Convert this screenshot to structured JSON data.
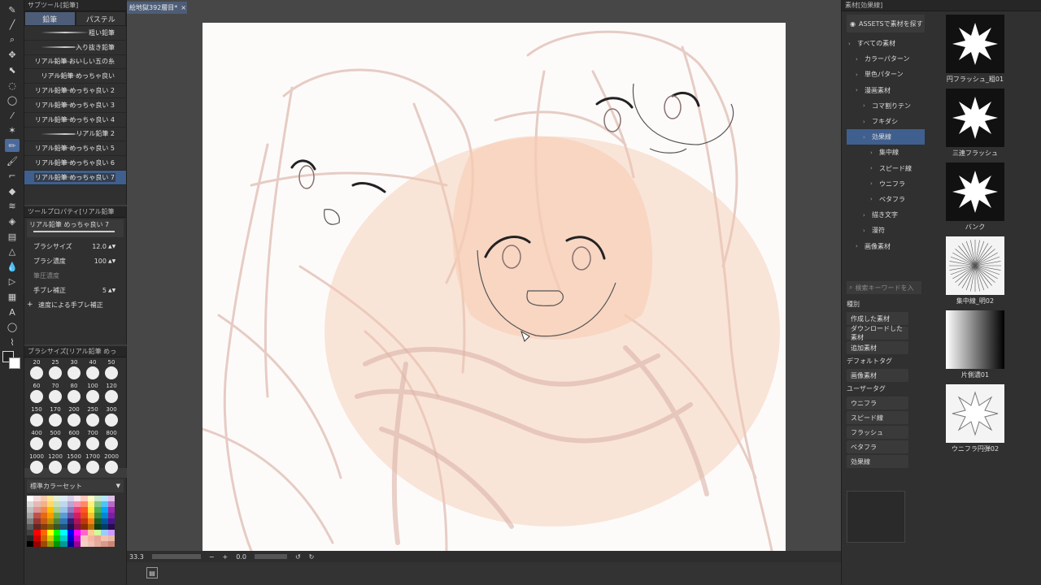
{
  "toolbar": {
    "tools": [
      {
        "name": "pen-icon",
        "glyph": "✎"
      },
      {
        "name": "line-icon",
        "glyph": "╱"
      },
      {
        "name": "zoom-icon",
        "glyph": "⌕"
      },
      {
        "name": "move-icon",
        "glyph": "✥"
      },
      {
        "name": "object-icon",
        "glyph": "⬉"
      },
      {
        "name": "select-icon",
        "glyph": "◌"
      },
      {
        "name": "lasso-icon",
        "glyph": "◯"
      },
      {
        "name": "eyedropper-icon",
        "glyph": "⁄"
      },
      {
        "name": "magic-wand-icon",
        "glyph": "✶"
      },
      {
        "name": "pencil-tool-icon",
        "glyph": "✏",
        "active": true
      },
      {
        "name": "brush-icon",
        "glyph": "🖌"
      },
      {
        "name": "airbrush-icon",
        "glyph": "⌐"
      },
      {
        "name": "eraser-icon",
        "glyph": "◆"
      },
      {
        "name": "blend-icon",
        "glyph": "≋"
      },
      {
        "name": "fill-icon",
        "glyph": "◈"
      },
      {
        "name": "gradient-icon",
        "glyph": "▤"
      },
      {
        "name": "figure-icon",
        "glyph": "△"
      },
      {
        "name": "blur-icon",
        "glyph": "💧"
      },
      {
        "name": "ruler-icon",
        "glyph": "▷"
      },
      {
        "name": "frame-icon",
        "glyph": "▦"
      },
      {
        "name": "text-icon",
        "glyph": "A"
      },
      {
        "name": "balloon-icon",
        "glyph": "◯"
      },
      {
        "name": "correction-icon",
        "glyph": "⌇"
      }
    ]
  },
  "subtool": {
    "header": "サブツール[鉛筆]",
    "tabs": [
      "鉛筆",
      "パステル"
    ],
    "brushes": [
      "粗い鉛筆",
      "入り抜き鉛筆",
      "リアル鉛筆 おいしい五の糸",
      "リアル鉛筆 めっちゃ良い",
      "リアル鉛筆 めっちゃ良い 2",
      "リアル鉛筆 めっちゃ良い 3",
      "リアル鉛筆 めっちゃ良い 4",
      "リアル鉛筆 2",
      "リアル鉛筆 めっちゃ良い 5",
      "リアル鉛筆 めっちゃ良い 6",
      "リアル鉛筆 めっちゃ良い 7"
    ]
  },
  "props": {
    "header": "ツールプロパティ[リアル鉛筆",
    "brush_name": "リアル鉛筆 めっちゃ良い 7",
    "size_label": "ブラシサイズ",
    "size_value": "12.0",
    "density_label": "ブラシ濃度",
    "density_value": "100",
    "stabilize_label": "筆圧濃度",
    "correction_label": "手ブレ補正",
    "correction_value": "5",
    "speed_label": "速度による手ブレ補正"
  },
  "sizes": {
    "header": "ブラシサイズ[リアル鉛筆 めっ",
    "values": [
      "20",
      "25",
      "30",
      "40",
      "50",
      "60",
      "70",
      "80",
      "100",
      "120",
      "150",
      "170",
      "200",
      "250",
      "300",
      "400",
      "500",
      "600",
      "700",
      "800",
      "1000",
      "1200",
      "1500",
      "1700",
      "2000"
    ]
  },
  "colorset": {
    "name": "標準カラーセット",
    "colors": [
      "#ffffff",
      "#f2dcdb",
      "#f8cbad",
      "#ffe699",
      "#e2efda",
      "#ddebf7",
      "#d9d2e9",
      "#fce4ec",
      "#ffccbc",
      "#fff9c4",
      "#c8e6c9",
      "#b3e5fc",
      "#e1bee7",
      "#d9d9d9",
      "#e6b8b7",
      "#f4b183",
      "#ffd966",
      "#c6e0b4",
      "#bdd7ee",
      "#b4a7d6",
      "#f48fb1",
      "#ff8a65",
      "#fff176",
      "#81c784",
      "#4fc3f7",
      "#ba68c8",
      "#bfbfbf",
      "#da9694",
      "#f08a4b",
      "#ffc000",
      "#a9d08e",
      "#9bc2e6",
      "#8e7cc3",
      "#ec407a",
      "#ff5722",
      "#ffeb3b",
      "#4caf50",
      "#03a9f4",
      "#9c27b0",
      "#a6a6a6",
      "#c0504d",
      "#e46c0a",
      "#ff9900",
      "#70ad47",
      "#5b9bd5",
      "#674ea7",
      "#d81b60",
      "#e64a19",
      "#fbc02d",
      "#388e3c",
      "#0288d1",
      "#7b1fa2",
      "#808080",
      "#953735",
      "#c55a11",
      "#bf8f00",
      "#548235",
      "#2e75b6",
      "#351c75",
      "#ad1457",
      "#bf360c",
      "#f57f17",
      "#1b5e20",
      "#01579b",
      "#4a148c",
      "#595959",
      "#632523",
      "#843c0c",
      "#7f6000",
      "#375623",
      "#1f4e79",
      "#20124d",
      "#880e4f",
      "#8d2b00",
      "#b36b00",
      "#0d3d12",
      "#003c6b",
      "#2a0a50",
      "#404040",
      "#ff0000",
      "#ff6600",
      "#ffff00",
      "#00ff00",
      "#00ffff",
      "#0000ff",
      "#ff00ff",
      "#ff66cc",
      "#ffcc99",
      "#ccff99",
      "#99ccff",
      "#cc99ff",
      "#262626",
      "#cc0000",
      "#cc6600",
      "#cccc00",
      "#00cc00",
      "#00cccc",
      "#0000cc",
      "#cc00cc",
      "#f9c8c0",
      "#f4b6a3",
      "#e8a798",
      "#f2c2b0",
      "#e9b9a8",
      "#000000",
      "#990000",
      "#994c00",
      "#999900",
      "#009900",
      "#009999",
      "#000099",
      "#990099",
      "#f5d0c5",
      "#eec1b2",
      "#e3ad9e",
      "#d9998a",
      "#c98675"
    ]
  },
  "document": {
    "tab_label": "絵地獄392層目*",
    "zoom": "33.3",
    "angle": "0.0"
  },
  "material": {
    "header": "素材[効果線]",
    "assets_button": "ASSETSで素材を探す",
    "tree": [
      {
        "label": "すべての素材",
        "indent": 0
      },
      {
        "label": "カラーパターン",
        "indent": 1
      },
      {
        "label": "単色パターン",
        "indent": 1
      },
      {
        "label": "漫画素材",
        "indent": 1
      },
      {
        "label": "コマ割りテン",
        "indent": 2
      },
      {
        "label": "フキダシ",
        "indent": 2
      },
      {
        "label": "効果線",
        "indent": 2,
        "active": true
      },
      {
        "label": "集中線",
        "indent": 3
      },
      {
        "label": "スピード線",
        "indent": 3
      },
      {
        "label": "ウニフラ",
        "indent": 3
      },
      {
        "label": "ベタフラ",
        "indent": 3
      },
      {
        "label": "描き文字",
        "indent": 2
      },
      {
        "label": "漫符",
        "indent": 2
      },
      {
        "label": "画像素材",
        "indent": 1
      }
    ],
    "search_placeholder": "検索キーワードを入",
    "kind_label": "種別",
    "kind_tags": [
      "作成した素材",
      "ダウンロードした素材",
      "追加素材"
    ],
    "default_tag_label": "デフォルトタグ",
    "default_tags": [
      "画像素材"
    ],
    "user_tag_label": "ユーザータグ",
    "user_tags": [
      "ウニフラ",
      "スピード線",
      "フラッシュ",
      "ベタフラ",
      "効果線"
    ],
    "thumbs": [
      "円フラッシュ_粗01",
      "三連フラッシュ",
      "バンク",
      "集中線_明02",
      "片側濃01",
      "ウニフラ円弾02"
    ]
  }
}
